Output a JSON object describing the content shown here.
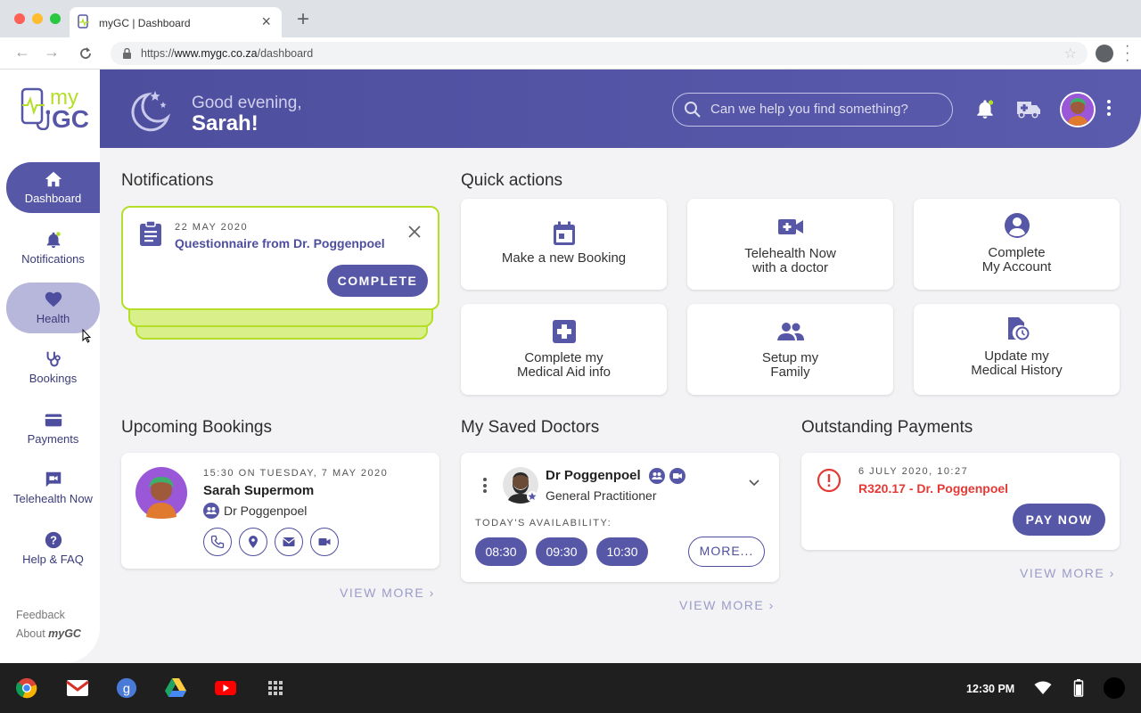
{
  "browser": {
    "tab_title": "myGC | Dashboard",
    "url_prefix": "https://",
    "url_host": "www.mygc.co.za",
    "url_path": "/dashboard"
  },
  "sidebar": {
    "logo_top": "my",
    "logo_bottom": "GC",
    "items": [
      {
        "label": "Dashboard",
        "icon": "home-icon"
      },
      {
        "label": "Notifications",
        "icon": "bell-icon"
      },
      {
        "label": "Health",
        "icon": "heart-icon"
      },
      {
        "label": "Bookings",
        "icon": "stethoscope-icon"
      },
      {
        "label": "Payments",
        "icon": "card-icon"
      },
      {
        "label": "Telehealth Now",
        "icon": "video-chat-icon"
      },
      {
        "label": "Help & FAQ",
        "icon": "help-icon"
      }
    ],
    "feedback": "Feedback",
    "about_prefix": "About ",
    "about_brand": "myGC"
  },
  "header": {
    "greeting": "Good evening,",
    "name": "Sarah!",
    "search_placeholder": "Can we help you find something?"
  },
  "notifications": {
    "title": "Notifications",
    "date": "22 MAY 2020",
    "message": "Questionnaire from Dr. Poggenpoel",
    "action": "COMPLETE"
  },
  "quick_actions": {
    "title": "Quick actions",
    "items": [
      {
        "line1": "Make a new Booking",
        "line2": "",
        "icon": "calendar-icon"
      },
      {
        "line1": "Telehealth Now",
        "line2": "with a doctor",
        "icon": "video-plus-icon"
      },
      {
        "line1": "Complete",
        "line2": "My Account",
        "icon": "account-icon"
      },
      {
        "line1": "Complete my",
        "line2": "Medical Aid info",
        "icon": "medical-plus-icon"
      },
      {
        "line1": "Setup my",
        "line2": "Family",
        "icon": "family-icon"
      },
      {
        "line1": "Update my",
        "line2": "Medical History",
        "icon": "history-icon"
      }
    ]
  },
  "upcoming": {
    "title": "Upcoming Bookings",
    "when": "15:30 ON TUESDAY, 7 MAY 2020",
    "patient": "Sarah Supermom",
    "doctor": "Dr Poggenpoel",
    "view_more": "VIEW MORE"
  },
  "saved_doctors": {
    "title": "My Saved Doctors",
    "name": "Dr Poggenpoel",
    "specialty": "General Practitioner",
    "availability_label": "TODAY'S AVAILABILITY:",
    "slots": [
      "08:30",
      "09:30",
      "10:30"
    ],
    "more": "MORE...",
    "view_more": "VIEW MORE"
  },
  "payments": {
    "title": "Outstanding Payments",
    "date": "6 JULY 2020, 10:27",
    "amount": "R320.17 - Dr. Poggenpoel",
    "action": "PAY NOW",
    "view_more": "VIEW MORE",
    "alert_color": "#e53935"
  },
  "taskbar": {
    "clock": "12:30 PM"
  },
  "colors": {
    "primary": "#5757a7",
    "accent_green": "#b4de28"
  }
}
